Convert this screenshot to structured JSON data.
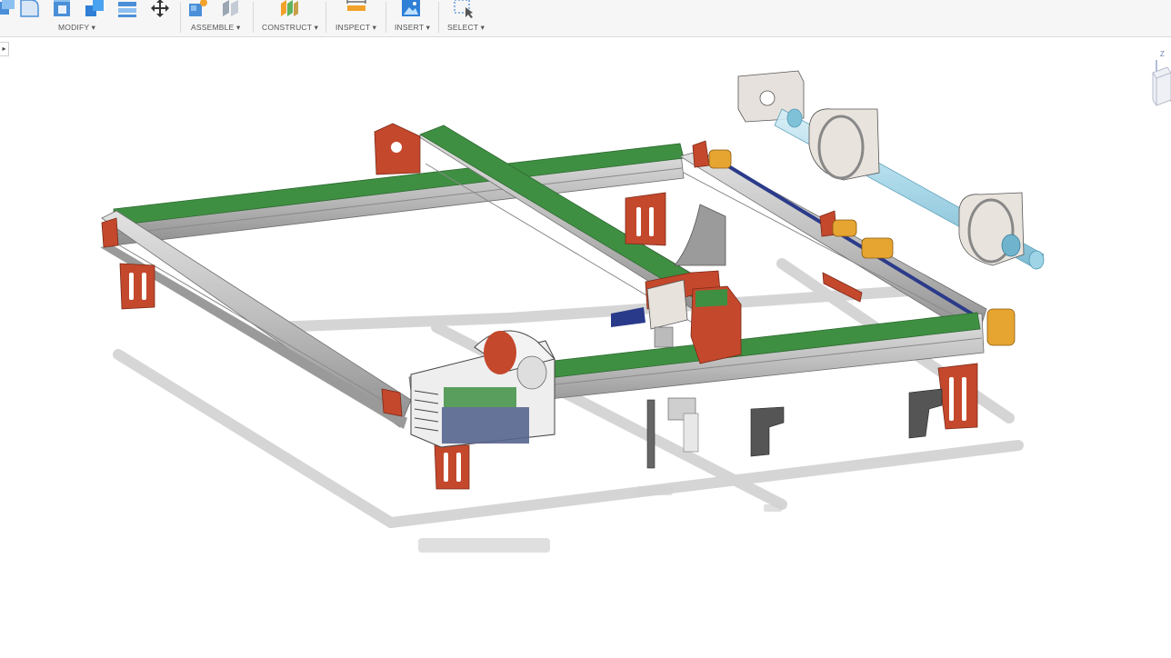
{
  "toolbar": {
    "groups": [
      {
        "label": "MODIFY ▾"
      },
      {
        "label": "ASSEMBLE ▾"
      },
      {
        "label": "CONSTRUCT ▾"
      },
      {
        "label": "INSPECT ▾"
      },
      {
        "label": "INSERT ▾"
      },
      {
        "label": "SELECT ▾"
      }
    ]
  },
  "side_tab": {
    "glyph": "▸"
  },
  "viewcube": {
    "axis_label": "Z"
  },
  "colors": {
    "extrusion": "#c9c9c9",
    "green_cover": "#3f8f43",
    "red_bracket": "#c4482c",
    "orange_wheel": "#e6a531",
    "laser_tube": "#9fd3e6",
    "toolbar_bg": "#f6f6f6"
  }
}
